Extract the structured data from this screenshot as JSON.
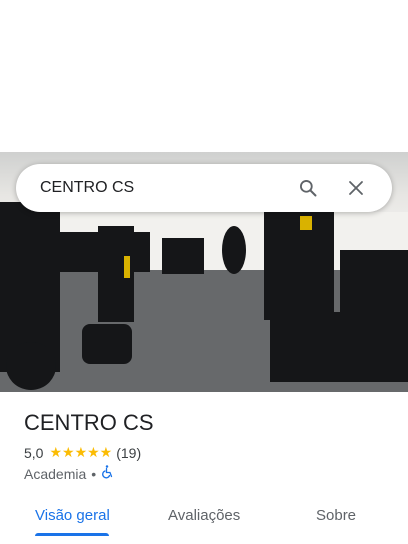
{
  "search": {
    "query": "CENTRO CS"
  },
  "place": {
    "name": "CENTRO CS",
    "rating": "5,0",
    "stars": "★★★★★",
    "reviews": "(19)",
    "category": "Academia",
    "separator": "•"
  },
  "tabs": [
    {
      "label": "Visão geral",
      "active": true
    },
    {
      "label": "Avaliações",
      "active": false
    },
    {
      "label": "Sobre",
      "active": false
    }
  ],
  "colors": {
    "accent": "#1a73e8",
    "stars": "#fbbc04"
  }
}
